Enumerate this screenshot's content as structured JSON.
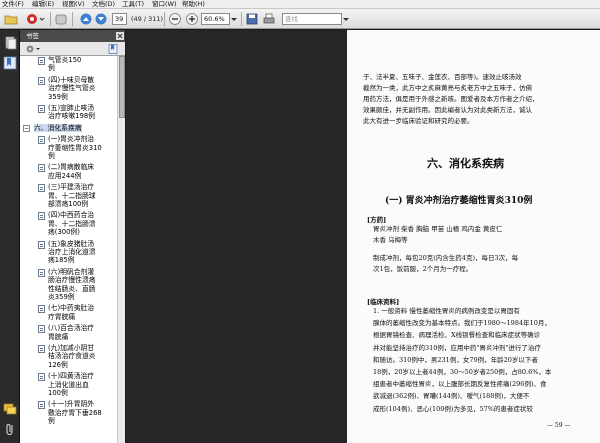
{
  "menubar": {
    "items": [
      "文件(F)",
      "编辑(E)",
      "视图(V)",
      "文档(D)",
      "工具(T)",
      "窗口(W)",
      "帮助(H)"
    ]
  },
  "toolbar": {
    "page_current": "39",
    "page_total": "(49 / 311)",
    "zoom": "60.6%",
    "search_placeholder": "查找"
  },
  "sidebar": {
    "title": "书签",
    "bookmarks": [
      {
        "lines": [
          "气管炎150",
          "例"
        ],
        "selected": false
      },
      {
        "lines": [
          "(四)十味贝母散",
          "治疗慢性气管炎",
          "359例"
        ],
        "selected": false
      },
      {
        "lines": [
          "(五)宣肺止咳汤",
          "治疗咳嗽198例"
        ],
        "selected": false
      },
      {
        "lines": [
          "六、消化系疾病"
        ],
        "selected": true
      },
      {
        "lines": [
          "(一)胃炎冲剂治",
          "疗萎缩性胃炎310",
          "例"
        ],
        "selected": false
      },
      {
        "lines": [
          "(二)胃病散临床",
          "应用244例"
        ],
        "selected": false
      },
      {
        "lines": [
          "(三)平建汤治疗",
          "胃、十二指肠球",
          "部溃疡100例"
        ],
        "selected": false
      },
      {
        "lines": [
          "(四)中西药合治",
          "胃、十二指肠溃",
          "疡(300例)"
        ],
        "selected": false
      },
      {
        "lines": [
          "(五)象皮猪肚汤",
          "治疗上消化道溃",
          "疡185例"
        ],
        "selected": false
      },
      {
        "lines": [
          "(六)明矾合剂灌",
          "肠治疗慢性溃疡",
          "性结肠炎、直肠",
          "炎359例"
        ],
        "selected": false
      },
      {
        "lines": [
          "(七)中药夷肚治",
          "疗胃脘痛"
        ],
        "selected": false
      },
      {
        "lines": [
          "(八)百合汤治疗",
          "胃脘痛"
        ],
        "selected": false
      },
      {
        "lines": [
          "(九)加减小阴甘",
          "桔汤治疗食道炎",
          "126例"
        ],
        "selected": false
      },
      {
        "lines": [
          "(十)四黄汤治疗",
          "上消化道出血",
          "100例"
        ],
        "selected": false
      },
      {
        "lines": [
          "(十一)升胃阴外",
          "敷治疗胃下垂268",
          "例"
        ],
        "selected": false
      }
    ]
  },
  "document": {
    "top_lines": [
      "于、法半夏、五味子、金莲衣、百部等)。速效止咳汤效",
      "截然为一类，此方中之炙麻黄亮与炙老方中之五味子，仿佛",
      "用药方法，俱是用于外感之新咳。图爱者及本方作者之介绍，",
      "效果颇佳，并无副作用。因此编者认为对此类新方法，诚认",
      "此大有进一步临床验证和研究的必要。"
    ],
    "chapter_title": "六、消化系疾病",
    "section_title": "(一) 胃炎冲剂治疗萎缩性胃炎310例",
    "formula_heading": "[方药]",
    "formula_lines": [
      "胃炎冲剂  柴香  胸脑  甲苗  山楂  鸡内金  黄皮仁",
      "木香  乌梅等"
    ],
    "usage_lines": [
      "制成冲剂，每包20克(内含生药4克)，每日3次，每",
      "次1包，饭前服，2个月为一疗程。"
    ],
    "clinical_heading": "[临床资料]",
    "clinical_lines": [
      "1. 一般资料  慢性萎缩性胃炎的病例改变是以胃固有",
      "腺体的萎缩性改变为基本特点。我们于1980～1984年10月，",
      "根据胃镜检查、病理活检、X线钡餐检查和临床症状等确诊",
      "并对能坚持治疗的310例，应用中药\"胃炎冲剂\"进行了治疗",
      "和随访。310例中，男231例，女79例，年龄20岁以下者",
      "18例，20岁以上者44例，30～50岁者250例，占80.6%，本",
      "组患者中萎缩性胃炎，以上腹部长期反复性疼痛(296例)、食",
      "欲减退(362例)、胃嘈(144例)、嗳气(188例)，大便不",
      "成形(104例)、恶心(100例)为多见，57%的患者症状较"
    ],
    "page_number": "— 59 —"
  }
}
